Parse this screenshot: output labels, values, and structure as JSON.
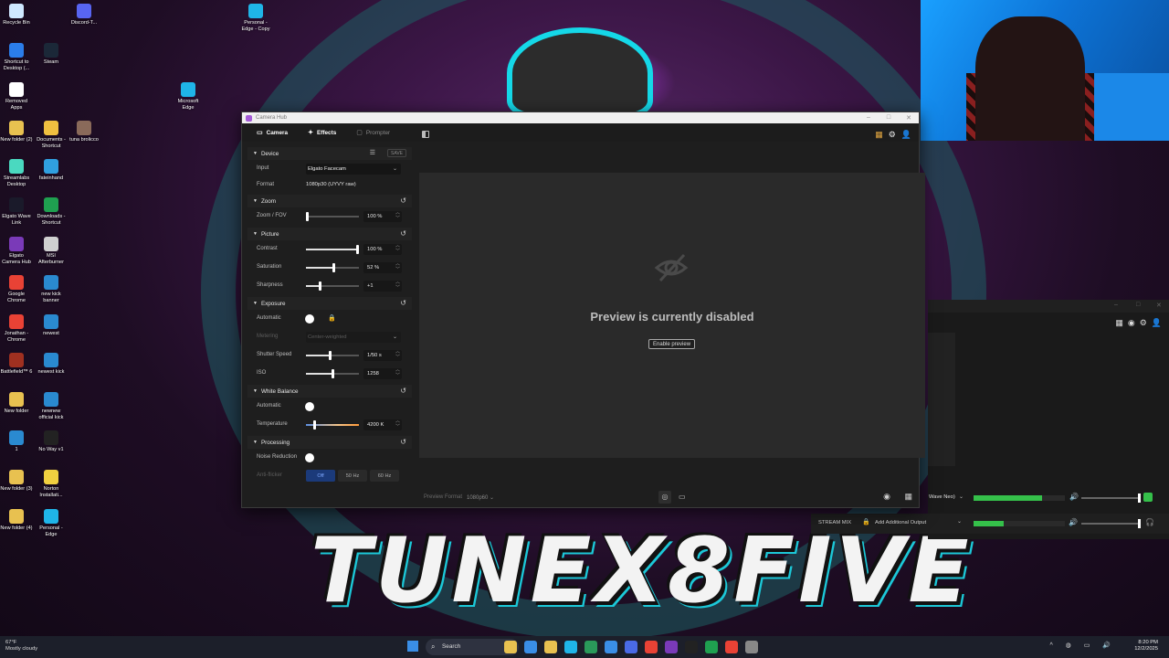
{
  "desktop": {
    "icons": [
      {
        "label": "Recycle Bin"
      },
      {
        "label": "Discord-T..."
      },
      {
        "label": "Personal - Edge - Copy"
      },
      {
        "label": "Shortcut to Desktop (..."
      },
      {
        "label": "Steam"
      },
      {
        "label": "Removed Apps"
      },
      {
        "label": "Microsoft Edge"
      },
      {
        "label": "New folder (2)"
      },
      {
        "label": "Documents - Shortcut"
      },
      {
        "label": "tuna brolicco"
      },
      {
        "label": "Streamlabs Desktop"
      },
      {
        "label": "fateinhand"
      },
      {
        "label": "Elgato Wave Link"
      },
      {
        "label": "Downloads - Shortcut"
      },
      {
        "label": "Elgato Camera Hub"
      },
      {
        "label": "MSI Afterburner"
      },
      {
        "label": "Google Chrome"
      },
      {
        "label": "new kick banner"
      },
      {
        "label": "Jonathan - Chrome"
      },
      {
        "label": "newest"
      },
      {
        "label": "Battlefield™ 6"
      },
      {
        "label": "newest kick"
      },
      {
        "label": "New folder"
      },
      {
        "label": "newnew official kick"
      },
      {
        "label": "1"
      },
      {
        "label": "No Way v1"
      },
      {
        "label": "New folder (3)"
      },
      {
        "label": "Norton Installati..."
      },
      {
        "label": "New folder (4)"
      },
      {
        "label": "Personal - Edge"
      }
    ],
    "wallpaper_text": "TUNEX8FIVE"
  },
  "window": {
    "title": "Camera Hub",
    "controls": [
      "–",
      "□",
      "✕"
    ],
    "tabs": [
      {
        "label": "Camera",
        "icon": "camera-icon"
      },
      {
        "label": "Effects",
        "icon": "wand-icon"
      },
      {
        "label": "Prompter",
        "icon": "prompter-icon"
      }
    ]
  },
  "panel": {
    "device": {
      "title": "Device",
      "save": "SAVE",
      "input_label": "Input",
      "input_value": "Elgato Facecam",
      "format_label": "Format",
      "format_value": "1080p30 (UYVY raw)"
    },
    "zoom": {
      "title": "Zoom",
      "label": "Zoom / FOV",
      "value": "100 %",
      "level": 0.0
    },
    "picture": {
      "title": "Picture",
      "contrast": {
        "label": "Contrast",
        "value": "100 %",
        "level": 1.0
      },
      "saturation": {
        "label": "Saturation",
        "value": "52 %",
        "level": 0.52
      },
      "sharpness": {
        "label": "Sharpness",
        "value": "+1",
        "level": 0.25
      }
    },
    "exposure": {
      "title": "Exposure",
      "automatic_label": "Automatic",
      "metering_label": "Metering",
      "metering_value": "Center-weighted",
      "shutter": {
        "label": "Shutter Speed",
        "value": "1/50 s",
        "level": 0.45
      },
      "iso": {
        "label": "ISO",
        "value": "1258",
        "level": 0.5
      }
    },
    "white_balance": {
      "title": "White Balance",
      "automatic_label": "Automatic",
      "temperature": {
        "label": "Temperature",
        "value": "4200 K",
        "level": 0.15
      }
    },
    "processing": {
      "title": "Processing",
      "noise_label": "Noise Reduction",
      "antiflicker_label": "Anti-flicker",
      "antiflicker_options": [
        "Off",
        "50 Hz",
        "60 Hz"
      ]
    }
  },
  "preview": {
    "message": "Preview is currently disabled",
    "button": "Enable preview",
    "format_label": "Preview Format",
    "format_value": "1080p60"
  },
  "mixer": {
    "channel_label": "Wave Neo)",
    "stream_label": "STREAM MIX",
    "output_label": "Add Additional Output",
    "channel_level": 0.75,
    "stream_level": 0.33,
    "accent": "#35c04a"
  },
  "taskbar": {
    "temp": "67°F",
    "weather": "Mostly cloudy",
    "search": "Search",
    "time": "8:20 PM",
    "date": "12/2/2025"
  }
}
